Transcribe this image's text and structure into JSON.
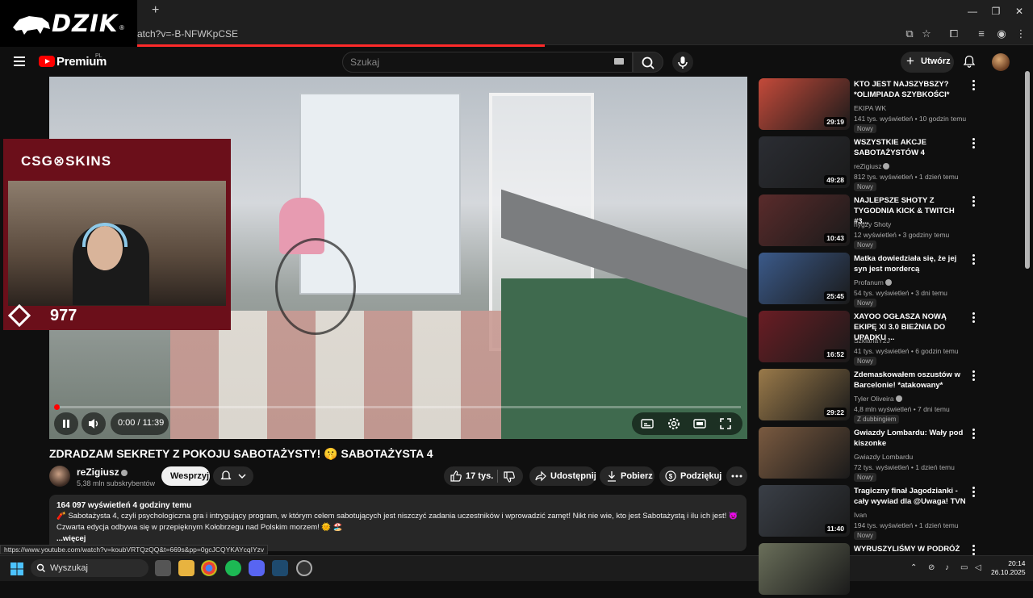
{
  "browser": {
    "tab_close": "×",
    "new_tab": "+",
    "url_fragment": "atch?v=-B-NFWKpCSE",
    "status_url": "https://www.youtube.com/watch?v=koubVRTQzQQ&t=669s&pp=0gcJCQYKAYcqIYzv",
    "window_controls": [
      "—",
      "❐",
      "✕"
    ]
  },
  "overlay_logo": {
    "text": "DZIK",
    "registered": "®"
  },
  "header": {
    "brand": "Premium",
    "region": "PL",
    "search_placeholder": "Szukaj",
    "create_label": "Utwórz"
  },
  "player": {
    "time": "0:00 / 11:39",
    "progress_fraction": 0.0
  },
  "webcam": {
    "sponsor": "CSG⊗SKINS",
    "count": "977"
  },
  "video": {
    "title": "ZDRADZAM SEKRETY Z POKOJU SABOTAŻYSTY! 🤫 SABOTAŻYSTA 4",
    "channel": "reZigiusz",
    "subscribers": "5,38 mln subskrybentów",
    "support_label": "Wesprzyj",
    "likes": "17 tys.",
    "share_label": "Udostępnij",
    "download_label": "Pobierz",
    "thanks_label": "Podziękuj"
  },
  "description": {
    "meta": "164 097 wyświetleń  4 godziny temu",
    "line1": "🧨 Sabotażysta 4, czyli psychologiczna gra i intrygujący program, w którym celem sabotujących jest niszczyć zadania uczestników i wprowadzić zamęt! Nikt nie wie, kto jest Sabotażystą i ilu ich jest! 👿",
    "line2": "Czwarta edycja odbywa się w przepięknym Kołobrzegu nad Polskim morzem! 🌞 🏖️",
    "more": "...więcej"
  },
  "recommendations": [
    {
      "title": "KTO JEST NAJSZYBSZY? *OLIMPIADA SZYBKOŚCI*",
      "channel": "EKIPA WK",
      "verified": false,
      "meta": "141 tys. wyświetleń • 10 godzin temu",
      "badge": "Nowy",
      "duration": "29:19",
      "thumb": "#c44a3a"
    },
    {
      "title": "WSZYSTKIE AKCJE SABOTAŻYSTÓW 4",
      "channel": "reZigiusz",
      "verified": true,
      "meta": "812 tys. wyświetleń • 1 dzień temu",
      "badge": "Nowy",
      "duration": "49:28",
      "thumb": "#2b2d33"
    },
    {
      "title": "NAJLEPSZE SHOTY Z TYGODNIA KICK & TWITCH #3...",
      "channel": "hygzy Shoty",
      "verified": false,
      "meta": "12 wyświetleń • 3 godziny temu",
      "badge": "Nowy",
      "duration": "10:43",
      "thumb": "#5a2b2b"
    },
    {
      "title": "Matka dowiedziała się, że jej syn jest mordercą",
      "channel": "Profanum",
      "verified": true,
      "meta": "54 tys. wyświetleń • 3 dni temu",
      "badge": "Nowy",
      "duration": "25:45",
      "thumb": "#3b5a8a"
    },
    {
      "title": "XAYOO OGŁASZA NOWĄ EKIPĘ XI 3.0  BIEŻNIA DO UPADKU ...",
      "channel": "SzklanaY2J",
      "verified": false,
      "meta": "41 tys. wyświetleń • 6 godzin temu",
      "badge": "Nowy",
      "duration": "16:52",
      "thumb": "#6a1d24"
    },
    {
      "title": "Zdemaskowałem oszustów w Barcelonie! *atakowany*",
      "channel": "Tyler Oliveira",
      "verified": true,
      "meta": "4,8 mln wyświetleń • 7 dni temu",
      "badge": "Z dubbingiem",
      "duration": "29:22",
      "thumb": "#9a7a4a"
    },
    {
      "title": "Gwiazdy Lombardu: Wały pod kiszonke",
      "channel": "Gwiazdy Lombardu",
      "verified": false,
      "meta": "72 tys. wyświetleń • 1 dzień temu",
      "badge": "Nowy",
      "duration": "",
      "thumb": "#7a5a40"
    },
    {
      "title": "Tragiczny finał Jagodzianki - cały wywiad dla @Uwaga! TVN",
      "channel": "Ivan",
      "verified": false,
      "meta": "194 tys. wyświetleń • 1 dzień temu",
      "badge": "Nowy",
      "duration": "11:40",
      "thumb": "#3a3f47"
    },
    {
      "title": "WYRUSZYLIŚMY W PODRÓŻ",
      "channel": "",
      "verified": false,
      "meta": "",
      "badge": "",
      "duration": "",
      "thumb": "#6a6f5a"
    }
  ],
  "taskbar": {
    "search_label": "Wyszukaj",
    "time": "20:14",
    "date": "26.10.2025"
  }
}
